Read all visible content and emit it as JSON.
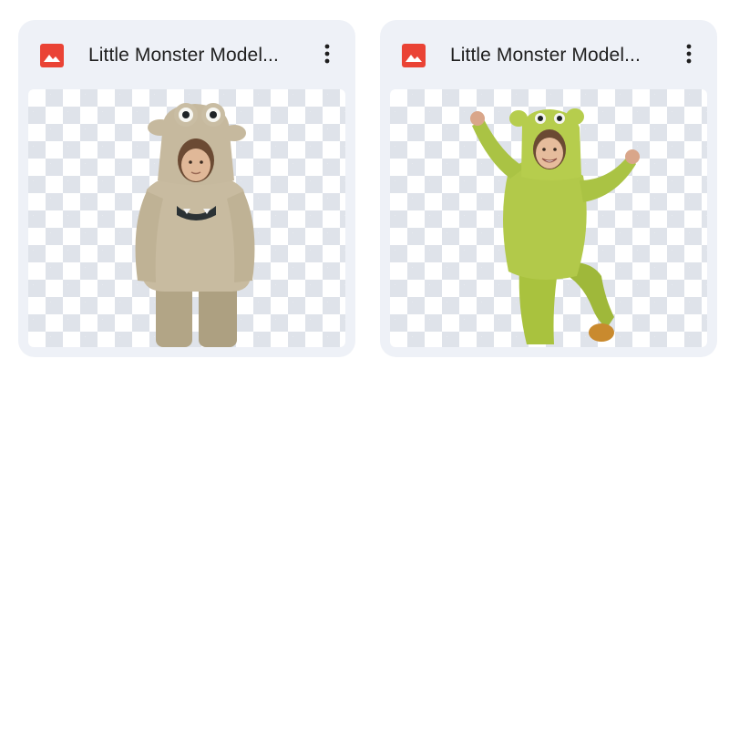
{
  "files": [
    {
      "title": "Little Monster Model...",
      "icon": "image-file-icon",
      "icon_color": "#ea4335",
      "more_icon": "more-vert-icon",
      "thumbnail": "beige-monster-costume-child"
    },
    {
      "title": "Little Monster Model...",
      "icon": "image-file-icon",
      "icon_color": "#ea4335",
      "more_icon": "more-vert-icon",
      "thumbnail": "green-monster-costume-child"
    }
  ],
  "colors": {
    "card_background": "#eef1f7",
    "checker_light": "#ffffff",
    "checker_dark": "#dfe3ea",
    "title_text": "#1f1f1f"
  }
}
